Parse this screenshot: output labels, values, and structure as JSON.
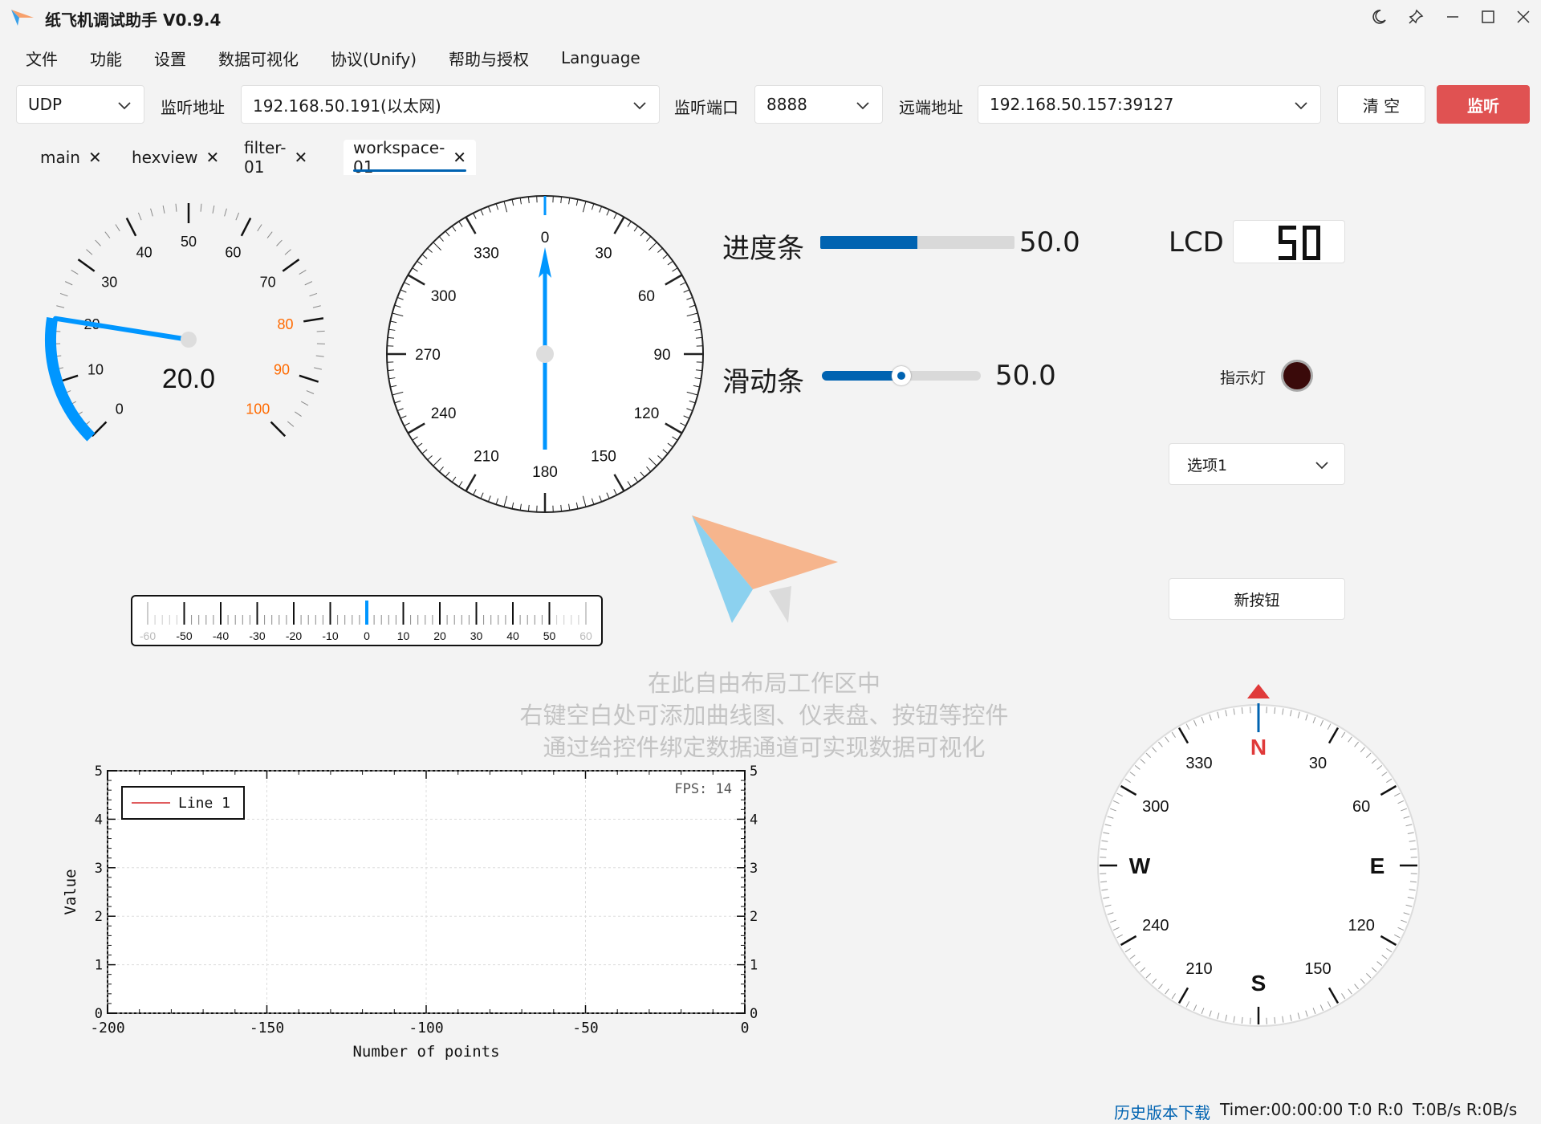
{
  "app": {
    "title": "纸飞机调试助手 V0.9.4"
  },
  "menu": [
    "文件",
    "功能",
    "设置",
    "数据可视化",
    "协议(Unify)",
    "帮助与授权",
    "Language"
  ],
  "toolbar": {
    "protocol": "UDP",
    "listen_addr_label": "监听地址",
    "listen_addr": "192.168.50.191(以太网)",
    "listen_port_label": "监听端口",
    "listen_port": "8888",
    "remote_addr_label": "远端地址",
    "remote_addr": "192.168.50.157:39127",
    "clear_label": "清 空",
    "listen_label": "监听"
  },
  "tabs": [
    {
      "label": "main",
      "active": false
    },
    {
      "label": "hexview",
      "active": false
    },
    {
      "label": "filter-01",
      "active": false
    },
    {
      "label": "workspace-01",
      "active": true
    }
  ],
  "gauge": {
    "value": 20.0,
    "value_text": "20.0",
    "min": 0,
    "max": 100,
    "labels": [
      "0",
      "10",
      "20",
      "30",
      "40",
      "50",
      "60",
      "70",
      "80",
      "90",
      "100"
    ],
    "warn_from": 80,
    "warn_color": "#ff6a00"
  },
  "dial": {
    "value": 0,
    "labels": [
      "0",
      "30",
      "60",
      "90",
      "120",
      "150",
      "180",
      "210",
      "240",
      "270",
      "300",
      "330"
    ]
  },
  "progress": {
    "label": "进度条",
    "value": 50.0,
    "value_text": "50.0",
    "max": 100
  },
  "slider": {
    "label": "滑动条",
    "value": 50.0,
    "value_text": "50.0",
    "max": 100
  },
  "lcd": {
    "label": "LCD",
    "value": "50"
  },
  "indicator": {
    "label": "指示灯",
    "color": "#3a0a0a"
  },
  "combo": {
    "selected": "选项1"
  },
  "new_button": {
    "label": "新按钮"
  },
  "ruler": {
    "value": 0,
    "labels": [
      "-60",
      "-50",
      "-40",
      "-30",
      "-20",
      "-10",
      "0",
      "10",
      "20",
      "30",
      "40",
      "50",
      "60"
    ]
  },
  "hint": {
    "line1": "在此自由布局工作区中",
    "line2": "右键空白处可添加曲线图、仪表盘、按钮等控件",
    "line3": "通过给控件绑定数据通道可实现数据可视化"
  },
  "compass": {
    "value": 0,
    "cardinals": {
      "N": "N",
      "E": "E",
      "S": "S",
      "W": "W"
    },
    "labels": [
      "30",
      "60",
      "120",
      "150",
      "210",
      "240",
      "300",
      "330"
    ]
  },
  "chart_data": {
    "type": "line",
    "series": [
      {
        "name": "Line 1",
        "x": [],
        "y": []
      }
    ],
    "xlabel": "Number of points",
    "ylabel": "Value",
    "xlim": [
      -200,
      0
    ],
    "ylim": [
      0,
      5
    ],
    "x_ticks": [
      "-200",
      "-150",
      "-100",
      "-50",
      "0"
    ],
    "y_ticks": [
      "0",
      "1",
      "2",
      "3",
      "4",
      "5"
    ],
    "fps_text": "FPS: 14",
    "grid": true,
    "legend": "top-left"
  },
  "status": {
    "history_link": "历史版本下载",
    "timer": "Timer:00:00:00",
    "tr": "T:0 R:0",
    "rate": "T:0B/s R:0B/s"
  },
  "colors": {
    "accent": "#0063b1",
    "gauge_blue": "#0096ff",
    "danger": "#e05252"
  }
}
